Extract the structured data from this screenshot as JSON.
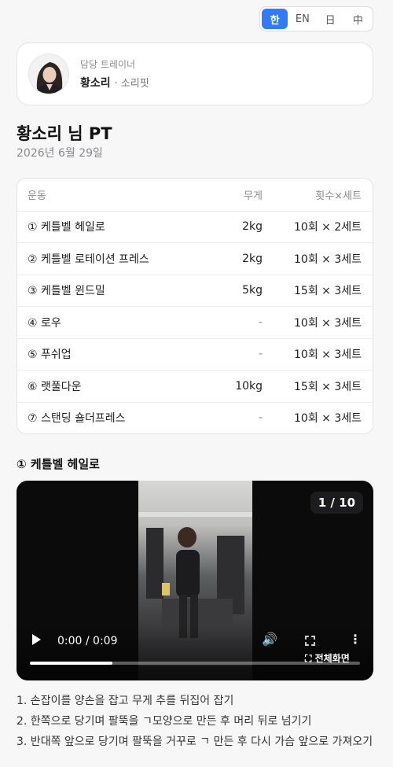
{
  "lang": {
    "items": [
      "한",
      "EN",
      "日",
      "中"
    ],
    "active": 0
  },
  "trainer": {
    "caption": "담당 트레이너",
    "name": "황소리",
    "gym": "· 소리핏"
  },
  "session": {
    "title": "황소리 님 PT",
    "date": "2026년 6월 29일"
  },
  "table": {
    "headers": {
      "exercise": "운동",
      "weight": "무게",
      "reps": "횟수×세트"
    },
    "rows": [
      {
        "name": "① 케틀벨 헤일로",
        "weight": "2kg",
        "reps": "10회 × 2세트"
      },
      {
        "name": "② 케틀벨 로테이션 프레스",
        "weight": "2kg",
        "reps": "10회 × 3세트"
      },
      {
        "name": "③ 케틀벨 윈드밀",
        "weight": "5kg",
        "reps": "15회 × 3세트"
      },
      {
        "name": "④ 로우",
        "weight": "-",
        "reps": "10회 × 3세트"
      },
      {
        "name": "⑤ 푸쉬업",
        "weight": "-",
        "reps": "10회 × 3세트"
      },
      {
        "name": "⑥ 랫풀다운",
        "weight": "10kg",
        "reps": "15회 × 3세트"
      },
      {
        "name": "⑦ 스탠딩 숄더프레스",
        "weight": "-",
        "reps": "10회 × 3세트"
      }
    ]
  },
  "detail": {
    "title": "① 케틀벨 헤일로",
    "video": {
      "counter": "1 / 10",
      "time": "0:00 / 0:09",
      "fullscreen_label": "전체화면",
      "progress": 0.25
    },
    "steps": [
      "1. 손잡이를 양손을 잡고 무게 추를 뒤집어 잡기",
      "2. 한쪽으로 당기며 팔뚝을 ㄱ모양으로 만든 후 머리 뒤로 넘기기",
      "3. 반대쪽 앞으로 당기며 팔뚝을 거꾸로 ㄱ 만든 후 다시 가슴 앞으로 가져오기"
    ]
  },
  "colors": {
    "accent": "#2f7cf6"
  }
}
